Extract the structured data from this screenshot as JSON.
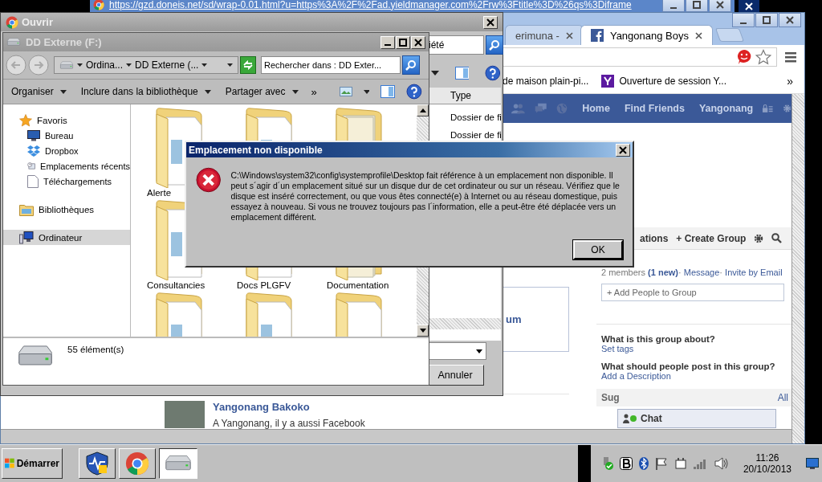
{
  "back_browser": {
    "address": "https://gzd.doneis.net/sd/wrap-0.01.html?u=https%3A%2F%2Fad.yieldmanager.com%2Frw%3Ftitle%3D%26qs%3Diframe"
  },
  "browser": {
    "tabs": [
      {
        "title": "erimuna -",
        "selected": false
      },
      {
        "title": "Yangonang Boys",
        "selected": true
      }
    ],
    "bookmarks": [
      "de maison plain-pi...",
      "Ouverture de session Y..."
    ],
    "bookmarks_more": "»",
    "fb_nav": [
      "Home",
      "Find Friends",
      "Yangonang"
    ],
    "group_tabs": [
      "ations",
      "+ Create Group"
    ],
    "members": "2 members",
    "separator": "·",
    "new_count": "(1 new)",
    "member_links": [
      "Message",
      "Invite by Email"
    ],
    "add_people_placeholder": "+ Add People to Group",
    "about": [
      {
        "question": "What is this group about?",
        "link": "Set tags"
      },
      {
        "question": "What should people post in this group?",
        "link": "Add a Description"
      }
    ],
    "suggested": "Sug",
    "see_all": "All",
    "chat": "Chat",
    "album_fragment": "um",
    "post": {
      "author": "Yangonang Bakoko",
      "text": "A Yangonang, il y a aussi Facebook"
    }
  },
  "open_dialog": {
    "title": "Ouvrir",
    "search_value": "iété",
    "column": "Type",
    "rows": [
      "Dossier de fi",
      "Dossier de fi"
    ],
    "cancel": "Annuler"
  },
  "explorer": {
    "title": "DD Externe (F:)",
    "breadcrumb": [
      "Ordina...",
      "DD Externe (..."
    ],
    "search_placeholder": "Rechercher dans : DD Exter...",
    "toolbar": [
      "Organiser",
      "Inclure dans la bibliothèque",
      "Partager avec"
    ],
    "toolbar_more": "»",
    "nav": [
      {
        "label": "Favoris",
        "kind": "star",
        "selected": false,
        "children": [
          {
            "label": "Bureau",
            "kind": "desktop",
            "selected": false
          },
          {
            "label": "Dropbox",
            "kind": "dropbox",
            "selected": false
          },
          {
            "label": "Emplacements récents",
            "kind": "recent",
            "selected": false
          },
          {
            "label": "Téléchargements",
            "kind": "download",
            "selected": false
          }
        ]
      },
      {
        "label": "Bibliothèques",
        "kind": "library",
        "selected": false
      },
      {
        "label": "Ordinateur",
        "kind": "computer",
        "selected": true
      }
    ],
    "folders": [
      {
        "label": "Alerte",
        "kind": "documents"
      },
      {
        "kind": "documents"
      },
      {
        "kind": "stack"
      },
      {
        "label": "Consultancies",
        "kind": "documents"
      },
      {
        "label": "Docs PLGFV",
        "kind": "documents"
      },
      {
        "label": "Documentation",
        "kind": "stack"
      },
      {
        "kind": "documents"
      },
      {
        "kind": "documents"
      },
      {
        "kind": "plain"
      }
    ],
    "status": "55 élément(s)"
  },
  "error_dialog": {
    "title": "Emplacement non disponible",
    "message": "C:\\Windows\\system32\\config\\systemprofile\\Desktop fait référence à un emplacement non disponible. Il peut s´agir d´un emplacement situé sur un disque dur de cet ordinateur ou sur un réseau. Vérifiez que le disque est inséré correctement, ou que vous êtes connecté(e) à Internet ou au réseau domestique, puis essayez à nouveau. Si vous ne trouvez toujours pas l´information, elle a peut-être été déplacée vers un emplacement différent.",
    "button": "OK"
  },
  "taskbar": {
    "start": "Démarrer",
    "time": "11:26",
    "date": "20/10/2013"
  }
}
